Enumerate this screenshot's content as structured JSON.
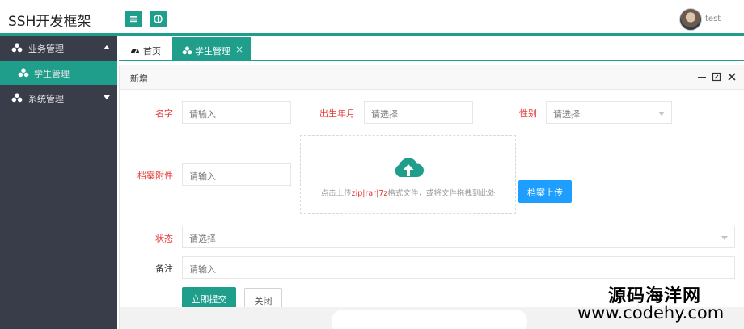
{
  "app": {
    "title": "SSH开发框架",
    "user_name": "test"
  },
  "header": {
    "menu_icon": "menu-icon",
    "globe_icon": "globe-icon"
  },
  "sidebar": {
    "items": [
      {
        "label": "业务管理",
        "icon": "cubes-icon",
        "expanded": true
      },
      {
        "label": "学生管理",
        "icon": "cubes-icon",
        "active": true
      },
      {
        "label": "系统管理",
        "icon": "cubes-icon",
        "expanded": false
      }
    ]
  },
  "tabs": [
    {
      "label": "首页",
      "icon": "dashboard-icon"
    },
    {
      "label": "学生管理",
      "icon": "cubes-icon",
      "active": true,
      "close": "×"
    }
  ],
  "panel": {
    "title": "新增"
  },
  "form": {
    "name_label": "名字",
    "name_placeholder": "请输入",
    "birth_label": "出生年月",
    "birth_placeholder": "请选择",
    "gender_label": "性别",
    "gender_placeholder": "请选择",
    "attachment_label": "档案附件",
    "attachment_placeholder": "请输入",
    "dropzone_prefix": "点击上传",
    "dropzone_formats": "zip|rar|7z",
    "dropzone_suffix": "格式文件，或将文件拖拽到此处",
    "upload_button": "档案上传",
    "status_label": "状态",
    "status_placeholder": "请选择",
    "remark_label": "备注",
    "remark_placeholder": "请输入",
    "submit_button": "立即提交",
    "close_button": "关闭"
  },
  "watermark": {
    "line1": "源码海洋网",
    "line2": "www.codehy.com"
  },
  "colors": {
    "accent": "#1f9e8c",
    "sidebar": "#393d49",
    "required": "#e53935",
    "upload_blue": "#1e9fff"
  }
}
